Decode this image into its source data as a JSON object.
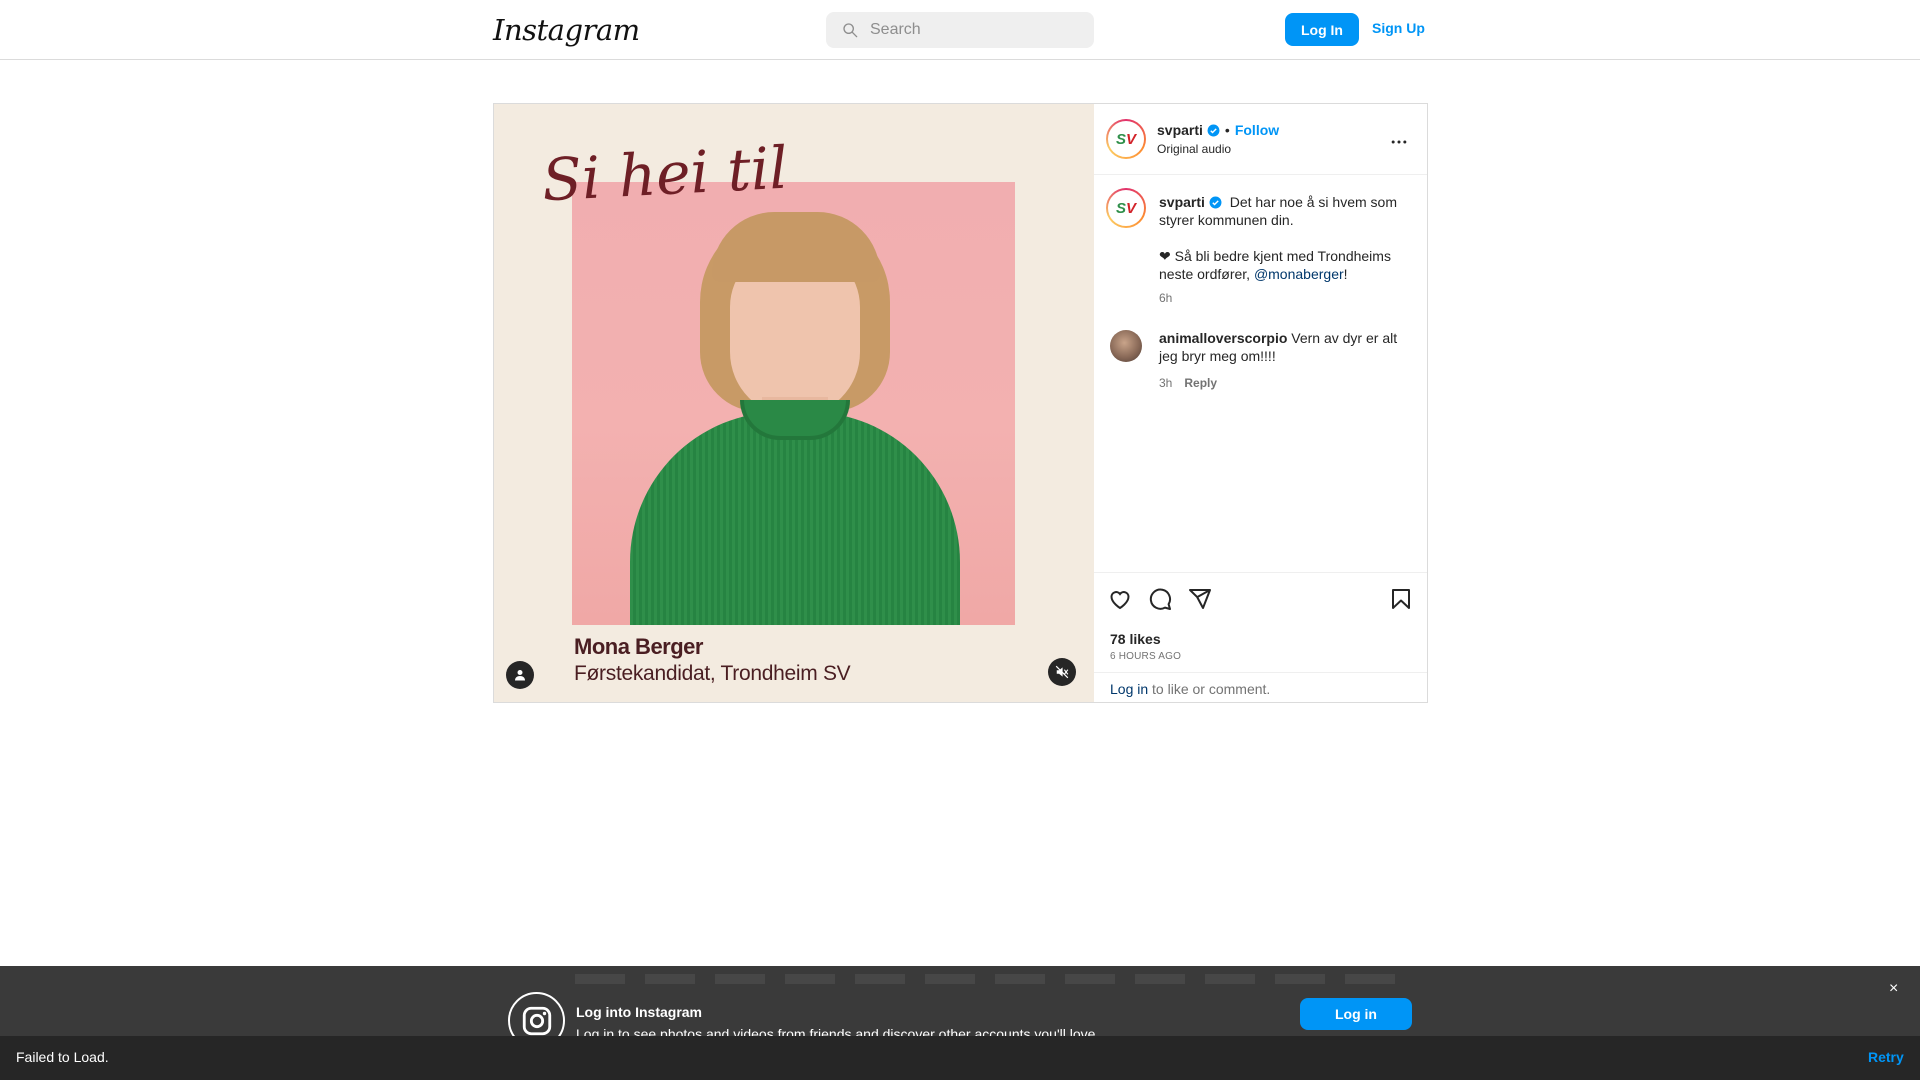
{
  "header": {
    "logo": "Instagram",
    "search_placeholder": "Search",
    "login_label": "Log In",
    "signup_label": "Sign Up"
  },
  "post": {
    "media": {
      "overlay_text": "Si hei til",
      "caption_name": "Mona Berger",
      "caption_role": "Førstekandidat, Trondheim SV"
    },
    "author": {
      "username": "svparti",
      "avatar_letters": [
        "S",
        "V"
      ],
      "audio": "Original audio",
      "separator": "•",
      "follow_label": "Follow"
    },
    "caption": {
      "username": "svparti",
      "line1": "⁣ Det har noe å si hvem som styrer kommunen din.",
      "line2_prefix": "❤ Så bli bedre kjent med Trondheims neste ordfører, ",
      "mention": "@monaberger",
      "line2_suffix": "!",
      "time": "6h"
    },
    "comments": [
      {
        "username": "animalloverscorpio",
        "text": "Vern av dyr er alt jeg bryr meg om!!!!",
        "time": "3h",
        "reply_label": "Reply"
      }
    ],
    "likes": "78 likes",
    "posted_ago": "6 HOURS AGO",
    "login_link": "Log in",
    "login_suffix": " to like or comment."
  },
  "overlay": {
    "title": "Log into Instagram",
    "subtitle": "Log in to see photos and videos from friends and discover other accounts you'll love.",
    "login_label": "Log in",
    "close_glyph": "×"
  },
  "toast": {
    "message": "Failed to Load.",
    "retry_label": "Retry"
  },
  "colors": {
    "accent": "#0095f6",
    "mention": "#00376b",
    "media_bg": "#f3ebe0",
    "photo_bg": "#f1aeb0",
    "overlay_bg": "#3a3a3a"
  },
  "icons": [
    "search-icon",
    "verified-icon",
    "more-icon",
    "heart-icon",
    "comment-icon",
    "share-icon",
    "bookmark-icon",
    "user-tag-icon",
    "muted-icon",
    "instagram-icon",
    "close-icon"
  ]
}
